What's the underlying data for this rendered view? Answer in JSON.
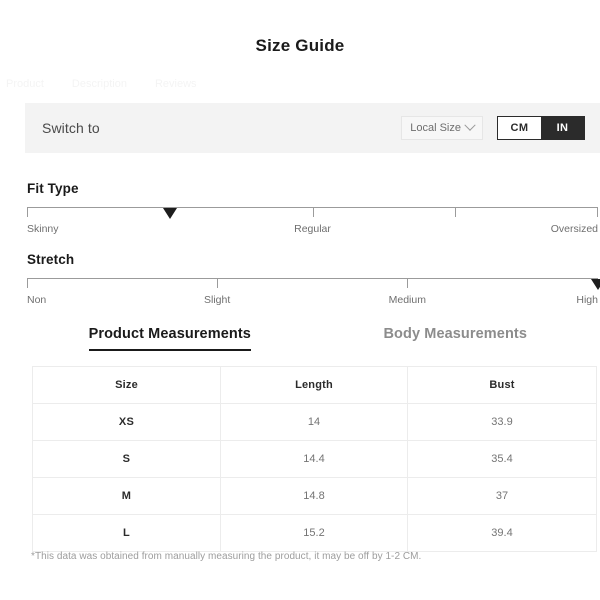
{
  "page_title": "Size Guide",
  "cutoff_strip": {
    "fragments": [
      "Product",
      "Description",
      "Reviews"
    ]
  },
  "switch_bar": {
    "label": "Switch to",
    "size_select": {
      "selected": "Local Size",
      "icon": "chevron-down-icon"
    },
    "units": [
      {
        "label": "CM",
        "selected": false
      },
      {
        "label": "IN",
        "selected": true
      }
    ]
  },
  "meters": [
    {
      "title": "Fit Type",
      "labels": [
        "Skinny",
        "Regular",
        "Oversized"
      ],
      "ticks_pct": [
        0,
        50,
        75,
        100
      ],
      "marker_pct": 25,
      "marker_value": "Skinny-Regular"
    },
    {
      "title": "Stretch",
      "labels": [
        "Non",
        "Slight",
        "Medium",
        "High"
      ],
      "ticks_pct": [
        0,
        33.3,
        66.6,
        100
      ],
      "marker_pct": 100,
      "marker_value": "High"
    }
  ],
  "tabs": [
    {
      "label": "Product Measurements",
      "active": true
    },
    {
      "label": "Body Measurements",
      "active": false
    }
  ],
  "table": {
    "headers": [
      "Size",
      "Length",
      "Bust"
    ],
    "rows": [
      {
        "size": "XS",
        "length": "14",
        "bust": "33.9"
      },
      {
        "size": "S",
        "length": "14.4",
        "bust": "35.4"
      },
      {
        "size": "M",
        "length": "14.8",
        "bust": "37"
      },
      {
        "size": "L",
        "length": "15.2",
        "bust": "39.4"
      }
    ]
  },
  "footnote": "*This data was obtained from manually measuring the product, it may be off by 1-2 CM.",
  "colors": {
    "accent": "#2b2b2b",
    "bar_bg": "#f3f3f3",
    "muted_text": "#747474",
    "table_border": "#ececec"
  }
}
